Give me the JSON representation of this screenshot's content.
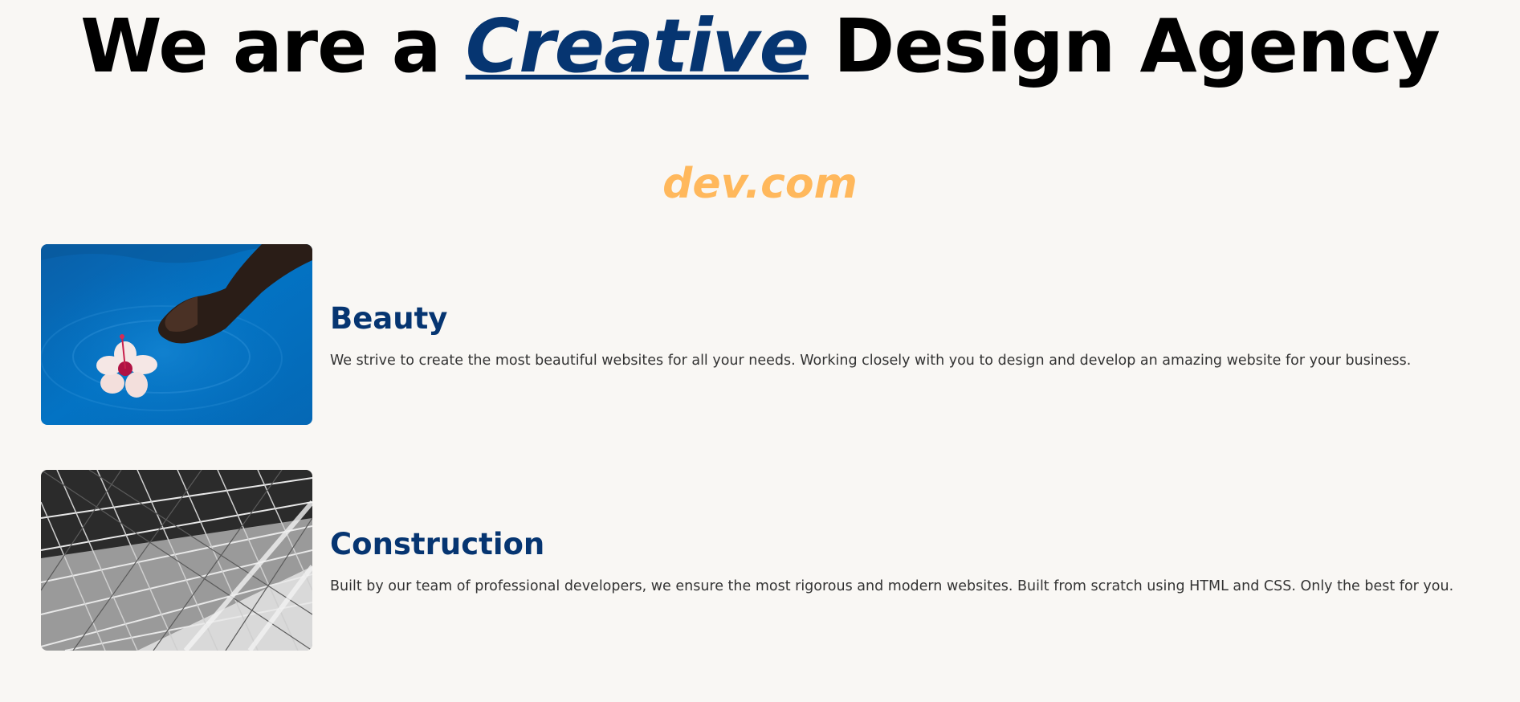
{
  "hero": {
    "title_before": "We are a ",
    "title_accent": "Creative",
    "title_after": " Design Agency"
  },
  "brand": {
    "text": "dev.com"
  },
  "features": [
    {
      "title": "Beauty",
      "description": "We strive to create the most beautiful websites for all your needs. Working closely with you to design and develop an amazing website for your business.",
      "image": "hand-with-flower-in-pool-image"
    },
    {
      "title": "Construction",
      "description": "Built by our team of professional developers, we ensure the most rigorous and modern websites. Built from scratch using HTML and CSS. Only the best for you.",
      "image": "steel-structure-image"
    }
  ],
  "colors": {
    "background": "#f9f7f4",
    "heading": "#000000",
    "accent_blue": "#063571",
    "brand_orange": "#ffb85c",
    "body_text": "#333333"
  }
}
